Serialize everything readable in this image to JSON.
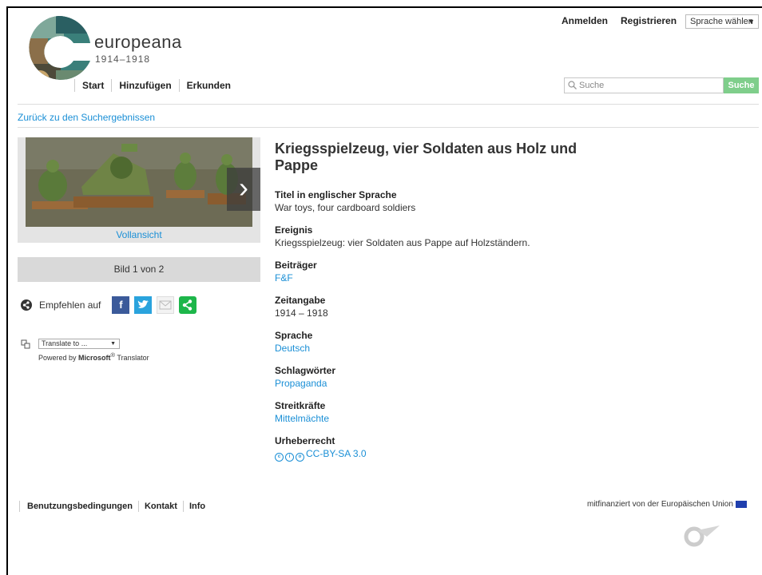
{
  "brand": {
    "name": "europeana",
    "years": "1914–1918"
  },
  "nav": {
    "items": [
      "Start",
      "Hinzufügen",
      "Erkunden"
    ]
  },
  "auth": {
    "login": "Anmelden",
    "register": "Registrieren"
  },
  "language_select": {
    "value": "Sprache wählen"
  },
  "search": {
    "placeholder": "Suche",
    "button": "Suche"
  },
  "back_link": "Zurück zu den Suchergebnissen",
  "image": {
    "fullview": "Vollansicht",
    "counter": "Bild 1 von 2"
  },
  "share": {
    "label": "Empfehlen auf",
    "facebook_glyph": "f"
  },
  "translate": {
    "select": "Translate to ...",
    "powered_prefix": "Powered by ",
    "powered_brand": "Microsoft",
    "powered_sup": "®",
    "powered_suffix": " Translator"
  },
  "item": {
    "title": "Kriegsspielzeug, vier Soldaten aus Holz und Pappe",
    "fields": [
      {
        "label": "Titel in englischer Sprache",
        "value": "War toys, four cardboard soldiers",
        "link": false
      },
      {
        "label": "Ereignis",
        "value": "Kriegsspielzeug: vier Soldaten aus Pappe auf Holzständern.",
        "link": false
      },
      {
        "label": "Beiträger",
        "value": "F&F",
        "link": true
      },
      {
        "label": "Zeitangabe",
        "value": "1914 – 1918",
        "link": false
      },
      {
        "label": "Sprache",
        "value": "Deutsch",
        "link": true
      },
      {
        "label": "Schlagwörter",
        "value": "Propaganda",
        "link": true
      },
      {
        "label": "Streitkräfte",
        "value": "Mittelmächte",
        "link": true
      },
      {
        "label": "Urheberrecht",
        "value": "CC-BY-SA 3.0",
        "link": true
      }
    ]
  },
  "footer": {
    "links": [
      "Benutzungsbedingungen",
      "Kontakt",
      "Info"
    ],
    "eu_note": "mitfinanziert von der Europäischen Union"
  },
  "colors": {
    "link": "#1a8fd6",
    "search_button": "#7fce8b",
    "facebook": "#3b5a9a",
    "twitter": "#2aa3dd",
    "share": "#1db64a"
  }
}
